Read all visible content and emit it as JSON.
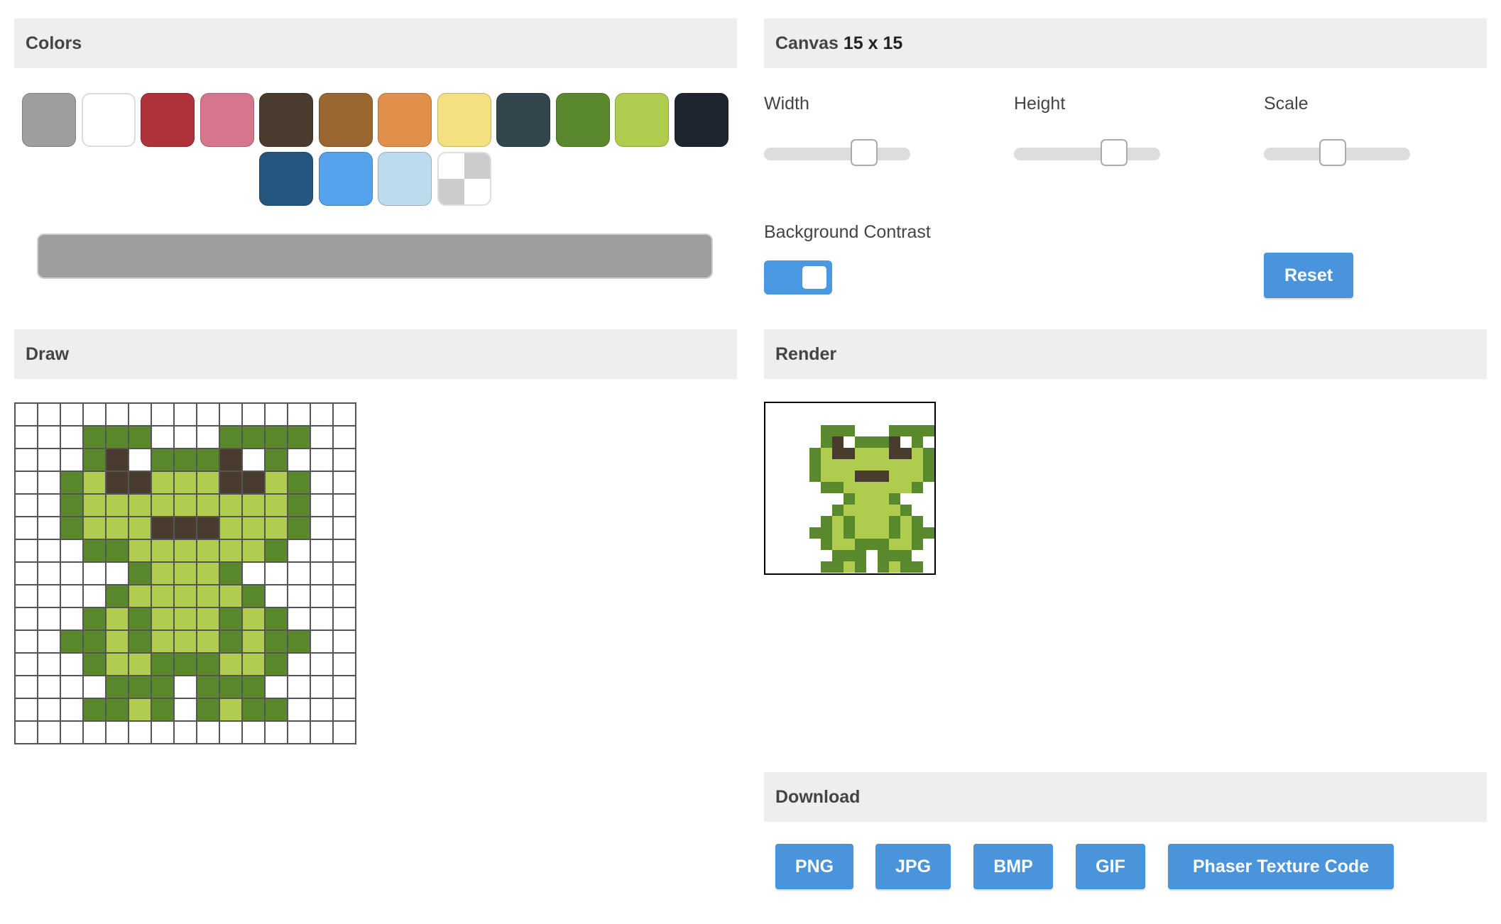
{
  "colors": {
    "title": "Colors",
    "palette": [
      {
        "name": "gray",
        "hex": "#9e9e9e"
      },
      {
        "name": "white",
        "hex": "#ffffff"
      },
      {
        "name": "red",
        "hex": "#ad323a"
      },
      {
        "name": "pink",
        "hex": "#d5768d"
      },
      {
        "name": "dark-brown",
        "hex": "#493c2f"
      },
      {
        "name": "brown",
        "hex": "#9b6731"
      },
      {
        "name": "orange",
        "hex": "#e0904a"
      },
      {
        "name": "yellow",
        "hex": "#f4e081"
      },
      {
        "name": "dark-slate",
        "hex": "#34464d"
      },
      {
        "name": "green",
        "hex": "#5a882c"
      },
      {
        "name": "lime",
        "hex": "#b0cc4f"
      },
      {
        "name": "navy-black",
        "hex": "#1e2531"
      },
      {
        "name": "blue",
        "hex": "#24567f"
      },
      {
        "name": "light-blue",
        "hex": "#56a3ec"
      },
      {
        "name": "pale-blue",
        "hex": "#bcdcee"
      },
      {
        "name": "transparent",
        "hex": ""
      }
    ],
    "selected": "#9e9e9e"
  },
  "canvas_settings": {
    "title_prefix": "Canvas",
    "title_size": "15 x 15",
    "width_label": "Width",
    "width": 15,
    "height_label": "Height",
    "height": 15,
    "scale_label": "Scale",
    "background_contrast_label": "Background Contrast",
    "background_contrast_on": true,
    "reset_label": "Reset"
  },
  "draw": {
    "title": "Draw",
    "key": {
      ".": "",
      "G": "#5a882c",
      "L": "#b0cc4f",
      "B": "#493c2f"
    },
    "rows": [
      "...............",
      "...GGG...GGGG..",
      "...GB.GGGB.G...",
      "..GLBBLLLBBLG..",
      "..GLLLLLLLLLG..",
      "..GLLLBBBLLLG..",
      "...GGLLLLLLG...",
      ".....GLLLG.....",
      "....GLLLLLG....",
      "...GLGLLLGLG...",
      "..GGLGLLLGLGG..",
      "...GLLGGGLLG...",
      "....GGG.GGG....",
      "...GGLG.GLGG...",
      "..............."
    ]
  },
  "render": {
    "title": "Render"
  },
  "download": {
    "title": "Download",
    "png": "PNG",
    "jpg": "JPG",
    "bmp": "BMP",
    "gif": "GIF",
    "phaser": "Phaser Texture Code"
  }
}
